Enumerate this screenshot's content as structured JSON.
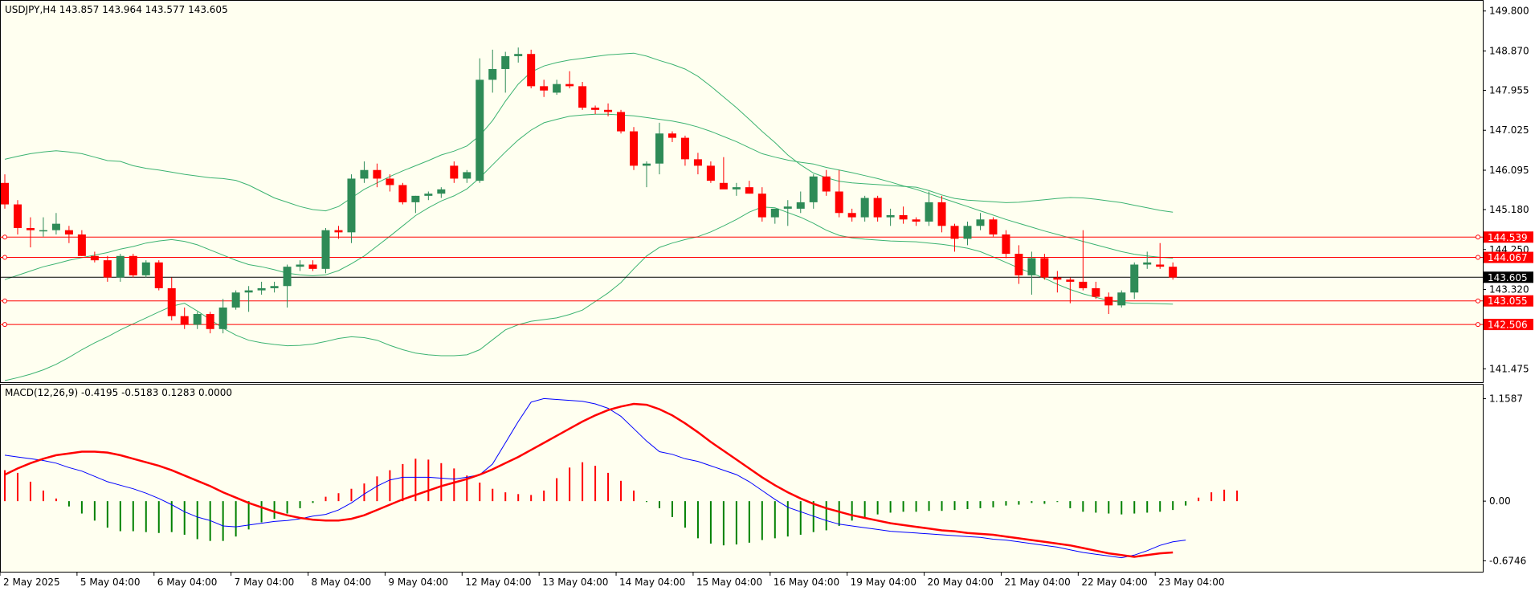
{
  "header": {
    "main_label": "USDJPY,H4  143.857 143.964 143.577 143.605",
    "macd_label": "MACD(12,26,9) -0.4195 -0.5183 0.1283 0.0000"
  },
  "colors": {
    "background": "#fffff0",
    "bull": "#2e8b57",
    "bear": "#ff0000",
    "band": "#3cb371",
    "level_line": "#ff0000",
    "price_line": "#000000",
    "macd_line": "#0000ff",
    "signal_line": "#ff0000",
    "hist_pos": "#ff0000",
    "hist_neg": "#008000"
  },
  "chart_data": [
    {
      "type": "candlestick",
      "symbol": "USDJPY",
      "timeframe": "H4",
      "ylim": [
        141.2,
        150.0
      ],
      "y_ticks": [
        "149.800",
        "148.870",
        "147.955",
        "147.025",
        "146.095",
        "145.180",
        "144.250",
        "143.320",
        "141.475"
      ],
      "x_labels": [
        "2 May 2025",
        "5 May 04:00",
        "6 May 04:00",
        "7 May 04:00",
        "8 May 04:00",
        "9 May 04:00",
        "12 May 04:00",
        "13 May 04:00",
        "14 May 04:00",
        "15 May 04:00",
        "16 May 04:00",
        "19 May 04:00",
        "20 May 04:00",
        "21 May 04:00",
        "22 May 04:00",
        "23 May 04:00"
      ],
      "x_label_slots": [
        0,
        6,
        12,
        18,
        24,
        30,
        36,
        42,
        48,
        54,
        60,
        66,
        72,
        78,
        84,
        90
      ],
      "horizontal_levels": [
        {
          "value": 144.539,
          "label": "144.539"
        },
        {
          "value": 144.067,
          "label": "144.067"
        },
        {
          "value": 143.055,
          "label": "143.055"
        },
        {
          "value": 142.506,
          "label": "142.506"
        }
      ],
      "current_price": {
        "value": 143.605,
        "label": "143.605"
      },
      "candles": [
        [
          145.8,
          146.0,
          145.2,
          145.3
        ],
        [
          145.3,
          145.4,
          144.6,
          144.75
        ],
        [
          144.75,
          145.0,
          144.3,
          144.7
        ],
        [
          144.7,
          145.0,
          144.55,
          144.7
        ],
        [
          144.7,
          145.1,
          144.6,
          144.85
        ],
        [
          144.7,
          144.8,
          144.4,
          144.6
        ],
        [
          144.6,
          144.7,
          144.1,
          144.1
        ],
        [
          144.1,
          144.2,
          143.95,
          144.0
        ],
        [
          144.0,
          144.1,
          143.5,
          143.6
        ],
        [
          143.6,
          144.15,
          143.5,
          144.1
        ],
        [
          144.1,
          144.15,
          143.6,
          143.65
        ],
        [
          143.65,
          144.0,
          143.6,
          143.95
        ],
        [
          143.95,
          144.0,
          143.3,
          143.35
        ],
        [
          143.35,
          143.6,
          142.6,
          142.7
        ],
        [
          142.7,
          142.9,
          142.4,
          142.5
        ],
        [
          142.5,
          142.8,
          142.4,
          142.75
        ],
        [
          142.75,
          142.8,
          142.3,
          142.4
        ],
        [
          142.4,
          143.1,
          142.3,
          142.9
        ],
        [
          142.9,
          143.3,
          142.85,
          143.25
        ],
        [
          143.25,
          143.4,
          142.8,
          143.3
        ],
        [
          143.3,
          143.5,
          143.2,
          143.35
        ],
        [
          143.35,
          143.5,
          143.25,
          143.4
        ],
        [
          143.4,
          143.9,
          142.9,
          143.85
        ],
        [
          143.85,
          144.0,
          143.75,
          143.9
        ],
        [
          143.9,
          144.0,
          143.75,
          143.8
        ],
        [
          143.8,
          144.75,
          143.7,
          144.7
        ],
        [
          144.7,
          144.8,
          144.5,
          144.65
        ],
        [
          144.65,
          146.0,
          144.4,
          145.9
        ],
        [
          145.9,
          146.3,
          145.8,
          146.1
        ],
        [
          146.1,
          146.25,
          145.7,
          145.9
        ],
        [
          145.9,
          146.0,
          145.6,
          145.75
        ],
        [
          145.75,
          145.8,
          145.3,
          145.35
        ],
        [
          145.35,
          145.5,
          145.1,
          145.5
        ],
        [
          145.5,
          145.6,
          145.4,
          145.55
        ],
        [
          145.55,
          145.7,
          145.45,
          145.65
        ],
        [
          146.2,
          146.3,
          145.8,
          145.9
        ],
        [
          145.9,
          146.1,
          145.8,
          146.05
        ],
        [
          145.85,
          148.7,
          145.8,
          148.2
        ],
        [
          148.2,
          148.9,
          147.9,
          148.45
        ],
        [
          148.45,
          148.85,
          147.9,
          148.75
        ],
        [
          148.75,
          148.95,
          148.6,
          148.8
        ],
        [
          148.8,
          148.9,
          148.0,
          148.05
        ],
        [
          148.05,
          148.2,
          147.8,
          147.95
        ],
        [
          147.9,
          148.2,
          147.85,
          148.1
        ],
        [
          148.1,
          148.4,
          148.0,
          148.05
        ],
        [
          148.05,
          148.15,
          147.5,
          147.55
        ],
        [
          147.55,
          147.6,
          147.4,
          147.5
        ],
        [
          147.5,
          147.65,
          147.35,
          147.45
        ],
        [
          147.45,
          147.5,
          146.95,
          147.0
        ],
        [
          147.0,
          147.1,
          146.1,
          146.2
        ],
        [
          146.2,
          146.3,
          145.7,
          146.25
        ],
        [
          146.25,
          147.2,
          146.0,
          146.95
        ],
        [
          146.95,
          147.0,
          146.75,
          146.85
        ],
        [
          146.85,
          146.9,
          146.2,
          146.35
        ],
        [
          146.35,
          146.5,
          146.0,
          146.2
        ],
        [
          146.2,
          146.3,
          145.8,
          145.85
        ],
        [
          145.8,
          146.4,
          145.7,
          145.65
        ],
        [
          145.65,
          145.8,
          145.5,
          145.7
        ],
        [
          145.7,
          145.85,
          145.55,
          145.55
        ],
        [
          145.55,
          145.7,
          144.9,
          145.0
        ],
        [
          145.0,
          145.2,
          144.85,
          145.2
        ],
        [
          145.2,
          145.4,
          144.8,
          145.25
        ],
        [
          145.2,
          145.6,
          145.1,
          145.35
        ],
        [
          145.35,
          146.0,
          145.2,
          145.95
        ],
        [
          145.95,
          146.1,
          145.5,
          145.6
        ],
        [
          145.6,
          146.1,
          145.0,
          145.1
        ],
        [
          145.1,
          145.2,
          144.9,
          145.0
        ],
        [
          145.0,
          145.5,
          144.9,
          145.45
        ],
        [
          145.45,
          145.5,
          144.9,
          145.0
        ],
        [
          145.0,
          145.2,
          144.8,
          145.05
        ],
        [
          145.05,
          145.25,
          144.85,
          144.95
        ],
        [
          144.95,
          145.0,
          144.8,
          144.9
        ],
        [
          144.9,
          145.6,
          144.8,
          145.35
        ],
        [
          145.35,
          145.5,
          144.65,
          144.8
        ],
        [
          144.8,
          144.85,
          144.2,
          144.5
        ],
        [
          144.5,
          144.9,
          144.35,
          144.8
        ],
        [
          144.8,
          145.1,
          144.7,
          144.95
        ],
        [
          144.95,
          145.0,
          144.55,
          144.6
        ],
        [
          144.6,
          144.7,
          144.05,
          144.15
        ],
        [
          144.15,
          144.35,
          143.45,
          143.65
        ],
        [
          143.65,
          144.2,
          143.2,
          144.05
        ],
        [
          144.05,
          144.15,
          143.55,
          143.6
        ],
        [
          143.6,
          143.75,
          143.25,
          143.55
        ],
        [
          143.55,
          143.6,
          143.0,
          143.5
        ],
        [
          143.5,
          144.7,
          143.3,
          143.35
        ],
        [
          143.35,
          143.5,
          143.1,
          143.15
        ],
        [
          143.15,
          143.25,
          142.75,
          142.95
        ],
        [
          142.95,
          143.3,
          142.9,
          143.25
        ],
        [
          143.25,
          143.95,
          143.1,
          143.9
        ],
        [
          143.9,
          144.2,
          143.8,
          143.95
        ],
        [
          143.9,
          144.4,
          143.8,
          143.85
        ],
        [
          143.85,
          143.95,
          143.55,
          143.6
        ]
      ],
      "bollinger": {
        "upper": [
          146.35,
          146.42,
          146.48,
          146.52,
          146.55,
          146.52,
          146.48,
          146.4,
          146.32,
          146.3,
          146.2,
          146.14,
          146.1,
          146.05,
          146.0,
          145.96,
          145.92,
          145.9,
          145.86,
          145.75,
          145.6,
          145.45,
          145.35,
          145.25,
          145.18,
          145.15,
          145.25,
          145.45,
          145.65,
          145.8,
          145.95,
          146.08,
          146.2,
          146.32,
          146.45,
          146.54,
          146.66,
          146.9,
          147.25,
          147.7,
          148.1,
          148.38,
          148.52,
          148.6,
          148.66,
          148.7,
          148.74,
          148.78,
          148.8,
          148.82,
          148.75,
          148.65,
          148.56,
          148.45,
          148.28,
          148.05,
          147.8,
          147.55,
          147.28,
          147.0,
          146.74,
          146.45,
          146.22,
          146.03,
          145.92,
          145.84,
          145.8,
          145.78,
          145.76,
          145.74,
          145.72,
          145.7,
          145.62,
          145.52,
          145.44,
          145.4,
          145.38,
          145.36,
          145.34,
          145.35,
          145.38,
          145.41,
          145.44,
          145.46,
          145.45,
          145.42,
          145.38,
          145.34,
          145.28,
          145.22,
          145.16,
          145.12
        ],
        "middle": [
          143.55,
          143.65,
          143.75,
          143.85,
          143.92,
          144.0,
          144.06,
          144.12,
          144.18,
          144.26,
          144.32,
          144.4,
          144.45,
          144.48,
          144.44,
          144.36,
          144.24,
          144.12,
          144.0,
          143.9,
          143.85,
          143.78,
          143.7,
          143.66,
          143.64,
          143.66,
          143.76,
          143.92,
          144.1,
          144.33,
          144.56,
          144.8,
          145.04,
          145.22,
          145.38,
          145.5,
          145.66,
          145.92,
          146.22,
          146.52,
          146.8,
          147.03,
          147.2,
          147.28,
          147.35,
          147.38,
          147.4,
          147.4,
          147.38,
          147.36,
          147.32,
          147.28,
          147.24,
          147.18,
          147.1,
          147.0,
          146.88,
          146.76,
          146.62,
          146.48,
          146.4,
          146.33,
          146.28,
          146.24,
          146.16,
          146.1,
          146.04,
          145.97,
          145.9,
          145.82,
          145.73,
          145.65,
          145.55,
          145.45,
          145.35,
          145.25,
          145.15,
          145.05,
          144.95,
          144.86,
          144.77,
          144.68,
          144.6,
          144.52,
          144.44,
          144.36,
          144.28,
          144.2,
          144.14,
          144.1,
          144.07,
          144.05
        ],
        "lower": [
          141.2,
          141.27,
          141.35,
          141.45,
          141.58,
          141.74,
          141.92,
          142.08,
          142.22,
          142.38,
          142.52,
          142.66,
          142.8,
          142.93,
          143.0,
          142.82,
          142.62,
          142.42,
          142.26,
          142.14,
          142.08,
          142.04,
          142.01,
          142.02,
          142.05,
          142.11,
          142.18,
          142.22,
          142.2,
          142.14,
          142.02,
          141.92,
          141.84,
          141.8,
          141.78,
          141.78,
          141.8,
          141.92,
          142.15,
          142.38,
          142.5,
          142.58,
          142.62,
          142.66,
          142.74,
          142.84,
          143.04,
          143.24,
          143.48,
          143.8,
          144.1,
          144.3,
          144.4,
          144.48,
          144.55,
          144.66,
          144.8,
          144.95,
          145.12,
          145.24,
          145.22,
          145.11,
          145.0,
          144.86,
          144.7,
          144.58,
          144.52,
          144.49,
          144.47,
          144.45,
          144.44,
          144.43,
          144.4,
          144.37,
          144.33,
          144.28,
          144.2,
          144.08,
          143.95,
          143.82,
          143.7,
          143.58,
          143.44,
          143.32,
          143.22,
          143.14,
          143.06,
          143.02,
          143.0,
          143.0,
          142.99,
          142.98
        ]
      }
    },
    {
      "type": "line",
      "name": "MACD(12,26,9)",
      "ylim": [
        -0.78,
        1.3
      ],
      "y_ticks": [
        "1.1587",
        "0.00",
        "-0.6746"
      ],
      "macd": [
        0.52,
        0.5,
        0.48,
        0.46,
        0.43,
        0.38,
        0.34,
        0.28,
        0.22,
        0.18,
        0.14,
        0.09,
        0.03,
        -0.04,
        -0.12,
        -0.18,
        -0.22,
        -0.28,
        -0.29,
        -0.27,
        -0.25,
        -0.23,
        -0.22,
        -0.2,
        -0.17,
        -0.15,
        -0.1,
        -0.02,
        0.08,
        0.17,
        0.24,
        0.27,
        0.27,
        0.27,
        0.26,
        0.25,
        0.27,
        0.3,
        0.42,
        0.66,
        0.9,
        1.12,
        1.16,
        1.15,
        1.14,
        1.13,
        1.1,
        1.05,
        0.96,
        0.82,
        0.68,
        0.56,
        0.53,
        0.48,
        0.45,
        0.4,
        0.35,
        0.3,
        0.22,
        0.12,
        0.02,
        -0.07,
        -0.12,
        -0.17,
        -0.22,
        -0.26,
        -0.28,
        -0.3,
        -0.32,
        -0.34,
        -0.35,
        -0.36,
        -0.37,
        -0.38,
        -0.39,
        -0.4,
        -0.41,
        -0.43,
        -0.44,
        -0.46,
        -0.48,
        -0.5,
        -0.52,
        -0.55,
        -0.58,
        -0.6,
        -0.62,
        -0.64,
        -0.61,
        -0.56,
        -0.5,
        -0.46,
        -0.44
      ],
      "signal": [
        0.3,
        0.37,
        0.43,
        0.48,
        0.52,
        0.54,
        0.56,
        0.56,
        0.55,
        0.52,
        0.48,
        0.44,
        0.4,
        0.35,
        0.29,
        0.23,
        0.17,
        0.1,
        0.04,
        -0.02,
        -0.07,
        -0.12,
        -0.16,
        -0.19,
        -0.21,
        -0.22,
        -0.22,
        -0.2,
        -0.16,
        -0.1,
        -0.04,
        0.02,
        0.07,
        0.12,
        0.17,
        0.21,
        0.25,
        0.3,
        0.36,
        0.43,
        0.5,
        0.58,
        0.66,
        0.74,
        0.82,
        0.9,
        0.97,
        1.03,
        1.07,
        1.1,
        1.09,
        1.04,
        0.97,
        0.88,
        0.78,
        0.67,
        0.57,
        0.47,
        0.37,
        0.27,
        0.18,
        0.1,
        0.03,
        -0.03,
        -0.08,
        -0.12,
        -0.16,
        -0.19,
        -0.22,
        -0.25,
        -0.27,
        -0.29,
        -0.31,
        -0.33,
        -0.34,
        -0.36,
        -0.37,
        -0.38,
        -0.4,
        -0.42,
        -0.44,
        -0.46,
        -0.48,
        -0.5,
        -0.53,
        -0.56,
        -0.59,
        -0.61,
        -0.63,
        -0.61,
        -0.59,
        -0.58
      ],
      "histogram": [
        0.35,
        0.32,
        0.22,
        0.12,
        0.03,
        -0.06,
        -0.14,
        -0.22,
        -0.3,
        -0.34,
        -0.34,
        -0.35,
        -0.36,
        -0.35,
        -0.38,
        -0.43,
        -0.45,
        -0.45,
        -0.4,
        -0.32,
        -0.24,
        -0.2,
        -0.14,
        -0.08,
        -0.02,
        0.05,
        0.09,
        0.14,
        0.2,
        0.28,
        0.35,
        0.42,
        0.48,
        0.47,
        0.43,
        0.37,
        0.29,
        0.21,
        0.14,
        0.1,
        0.08,
        0.07,
        0.12,
        0.26,
        0.38,
        0.44,
        0.4,
        0.32,
        0.23,
        0.12,
        -0.01,
        -0.08,
        -0.18,
        -0.3,
        -0.42,
        -0.48,
        -0.5,
        -0.49,
        -0.47,
        -0.44,
        -0.42,
        -0.4,
        -0.38,
        -0.35,
        -0.33,
        -0.28,
        -0.22,
        -0.18,
        -0.15,
        -0.13,
        -0.12,
        -0.12,
        -0.11,
        -0.11,
        -0.1,
        -0.09,
        -0.08,
        -0.07,
        -0.05,
        -0.04,
        -0.02,
        -0.03,
        -0.01,
        -0.08,
        -0.12,
        -0.13,
        -0.14,
        -0.15,
        -0.14,
        -0.13,
        -0.12,
        -0.1,
        -0.05,
        0.04,
        0.1,
        0.13,
        0.12
      ]
    }
  ]
}
